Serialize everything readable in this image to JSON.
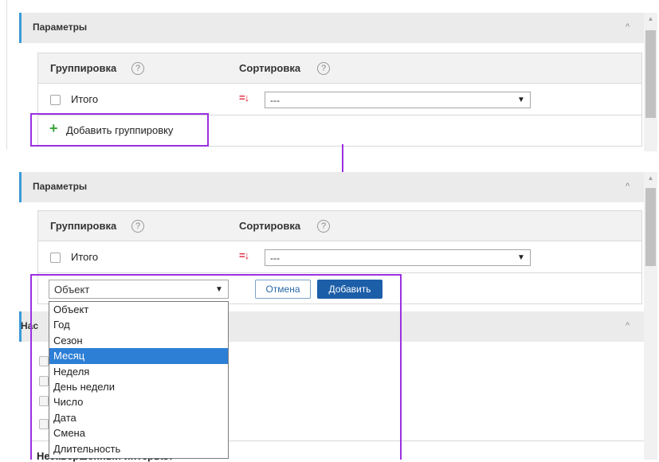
{
  "top_panel": {
    "section_title": "Параметры",
    "grouping_header": "Группировка",
    "sorting_header": "Сортировка",
    "help_glyph": "?",
    "row_label": "Итого",
    "sort_value": "---",
    "add_grouping_label": "Добавить группировку",
    "plus_glyph": "+"
  },
  "bottom_panel": {
    "section_title": "Параметры",
    "grouping_header": "Группировка",
    "sorting_header": "Сортировка",
    "help_glyph": "?",
    "row_label": "Итого",
    "sort_value": "---",
    "grouping_select_value": "Объект",
    "cancel_label": "Отмена",
    "add_label": "Добавить",
    "dropdown_options": [
      "Объект",
      "Год",
      "Сезон",
      "Месяц",
      "Неделя",
      "День недели",
      "Число",
      "Дата",
      "Смена",
      "Длительность"
    ],
    "selected_option": "Месяц",
    "hidden_section_title_fragment": "Нас",
    "hidden_text_fragment": "Незавершенный интервал"
  },
  "icons": {
    "chevron_up": "^",
    "caret_down": "▼",
    "sort_icon": "=↓",
    "scroll_up_arrow": "▲"
  },
  "colors": {
    "accent_blue": "#3a9ad9",
    "highlight_purple": "#9b30e0",
    "primary_button": "#1c5ea8",
    "selected_option": "#2d7fd6",
    "plus_green": "#3aa53a",
    "sort_red": "#e0243b"
  }
}
